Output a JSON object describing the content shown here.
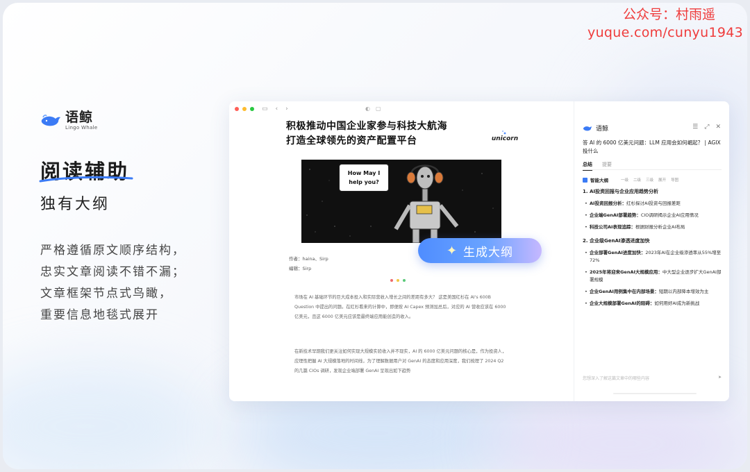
{
  "watermark": {
    "line1": "公众号：村雨遥",
    "line2": "yuque.com/cunyu1943"
  },
  "brand": {
    "name": "语鲸",
    "subtitle": "Lingo Whale"
  },
  "hero_text": {
    "headline": "阅读辅助",
    "subline": "独有大纲",
    "desc": [
      "严格遵循原文顺序结构，",
      "忠实文章阅读不错不漏；",
      "文章框架节点式鸟瞰，",
      "重要信息地毯式展开"
    ]
  },
  "doc": {
    "title_line1": "积极推动中国企业家参与科技大航海",
    "title_line2": "打造全球领先的资产配置平台",
    "unicorn_label": "unicorn",
    "bubble_text": [
      "How May I",
      "help you?"
    ],
    "author": "作者：haina、Sirp",
    "editor": "编辑：Sirp",
    "para1": "市场在 AI 基础环节的巨大成本投入和实际营收入增长之间的差距有多大？ 这是美国红杉在 AI's 600B Question 中提出的问题。在红杉看来的计算中，即便按 AI Capex 预测加总后，对应的 AI 营收应该在 6000 亿美元，且这 6000 亿美元应该是最终端应用能创造的收入。",
    "para2": "在新技术早期我们更关注如何实现大规模实验收入并不现实，AI 的 6000 亿美元问题的核心是，作为投资人，应理性把握 AI 大规模落地的时间线，为了理解数据用户对 GenAI 的态度和应用深度，我们梳理了 2024 Q2 的几篇 CIOs 调研，发现企业端部署 GenAI 呈现出如下趋势"
  },
  "generate_button": {
    "label": "生成大纲"
  },
  "panel": {
    "name": "语鲸",
    "title": "答 AI 的 6000 亿美元问题：LLM 应用会如何崛起？ | AGIX 投什么",
    "tabs": [
      "总结",
      "提要"
    ],
    "outline_label": "智能大纲",
    "controls": [
      "一级",
      "二级",
      "三级",
      "展开",
      "导图"
    ],
    "sections": [
      {
        "title": "1. AI投资回报与企业应用趋势分析",
        "items": [
          {
            "key": "AI投资回报分析：",
            "text": "红杉探讨AI投资与回报差距"
          },
          {
            "key": "企业端GenAI部署趋势：",
            "text": "CIO调研揭示企业AI应用情况"
          },
          {
            "key": "科技公司AI表现追踪：",
            "text": "根据财报分析企业AI布局"
          }
        ]
      },
      {
        "title": "2. 企业级GenAI渗透进度加快",
        "items": [
          {
            "key": "企业部署GenAI进度加快：",
            "text": "2023年AI在企业级渗透率从55%增至72%"
          },
          {
            "key": "2025年将迎来GenAI大规模应用：",
            "text": "中大型企业逐步扩大GenAI部署规模"
          },
          {
            "key": "企业GenAI用例集中在内部场景：",
            "text": "短期以内部降本增效为主"
          },
          {
            "key": "企业大规模部署GenAI的阻碍：",
            "text": "如何用好AI成为新挑战"
          }
        ]
      }
    ],
    "ask_placeholder": "您想深入了解这篇文章中的哪些内容"
  },
  "colors": {
    "accent": "#4f8dff",
    "watermark": "#ef3b3b"
  }
}
